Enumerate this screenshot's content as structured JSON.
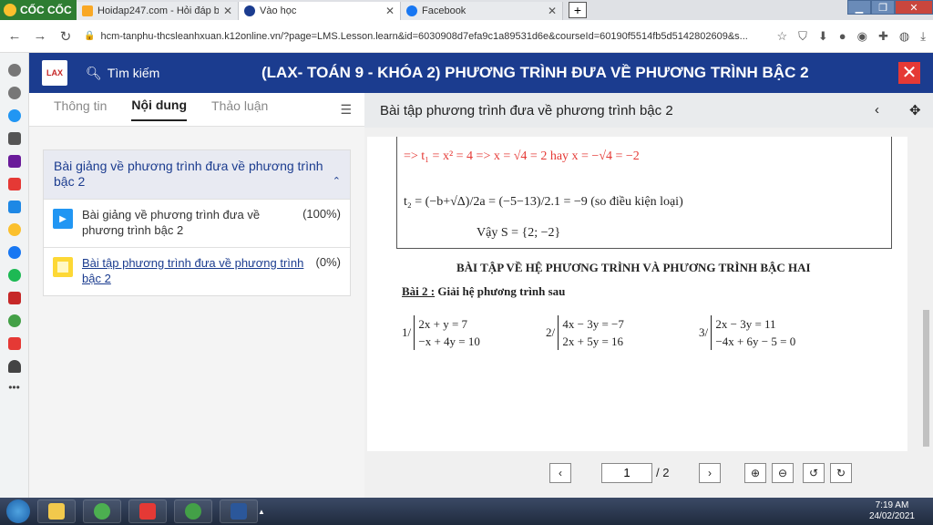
{
  "browser": {
    "brand": "CỐC CỐC",
    "tabs": [
      {
        "title": "Hoidap247.com - Hỏi đáp bài",
        "color": "#f9a825"
      },
      {
        "title": "Vào học",
        "color": "#1b3c8f"
      },
      {
        "title": "Facebook",
        "color": "#1877f2"
      }
    ],
    "url": "hcm-tanphu-thcsleanhxuan.k12online.vn/?page=LMS.Lesson.learn&id=6030908d7efa9c1a89531d6e&courseId=60190f5514fb5d5142802609&s..."
  },
  "app": {
    "logo": "LAX",
    "search_label": "Tìm kiếm",
    "title": "(LAX- TOÁN 9 - KHÓA 2) PHƯƠNG TRÌNH ĐƯA VỀ PHƯƠNG TRÌNH BẬC 2"
  },
  "left": {
    "tabs": [
      "Thông tin",
      "Nội dung",
      "Thảo luận"
    ],
    "section_title": "Bài giảng về phương trình đưa về phương trình bậc 2",
    "items": [
      {
        "title": "Bài giảng về phương trình đưa về phương trình bậc 2",
        "percent": "(100%)"
      },
      {
        "title": "Bài tập phương trình đưa về phương trình bậc 2",
        "percent": "(0%)"
      }
    ]
  },
  "viewer": {
    "title": "Bài tập phương trình đưa về phương trình bậc 2",
    "page_current": "1",
    "page_total": "/ 2",
    "doc": {
      "line1": "=> t₁ = x² = 4 => x = √4 = 2 hay x = −√4 = −2",
      "line2": "t₂ = (−b+√Δ)/2a = (−5−13)/2.1 = −9 (so điều kiện loại)",
      "line3": "Vậy S = {2; −2}",
      "heading": "BÀI TẬP VỀ HỆ PHƯƠNG TRÌNH VÀ PHƯƠNG TRÌNH BẬC HAI",
      "bai2": "Bài 2 :",
      "bai2_text": " Giải hệ phương trình sau",
      "systems": [
        {
          "label": "1/",
          "eq1": "2x + y = 7",
          "eq2": "−x + 4y = 10"
        },
        {
          "label": "2/",
          "eq1": "4x − 3y = −7",
          "eq2": "2x + 5y = 16"
        },
        {
          "label": "3/",
          "eq1": "2x − 3y = 11",
          "eq2": "−4x + 6y − 5 = 0"
        }
      ]
    }
  },
  "taskbar": {
    "time": "7:19 AM",
    "date": "24/02/2021"
  }
}
